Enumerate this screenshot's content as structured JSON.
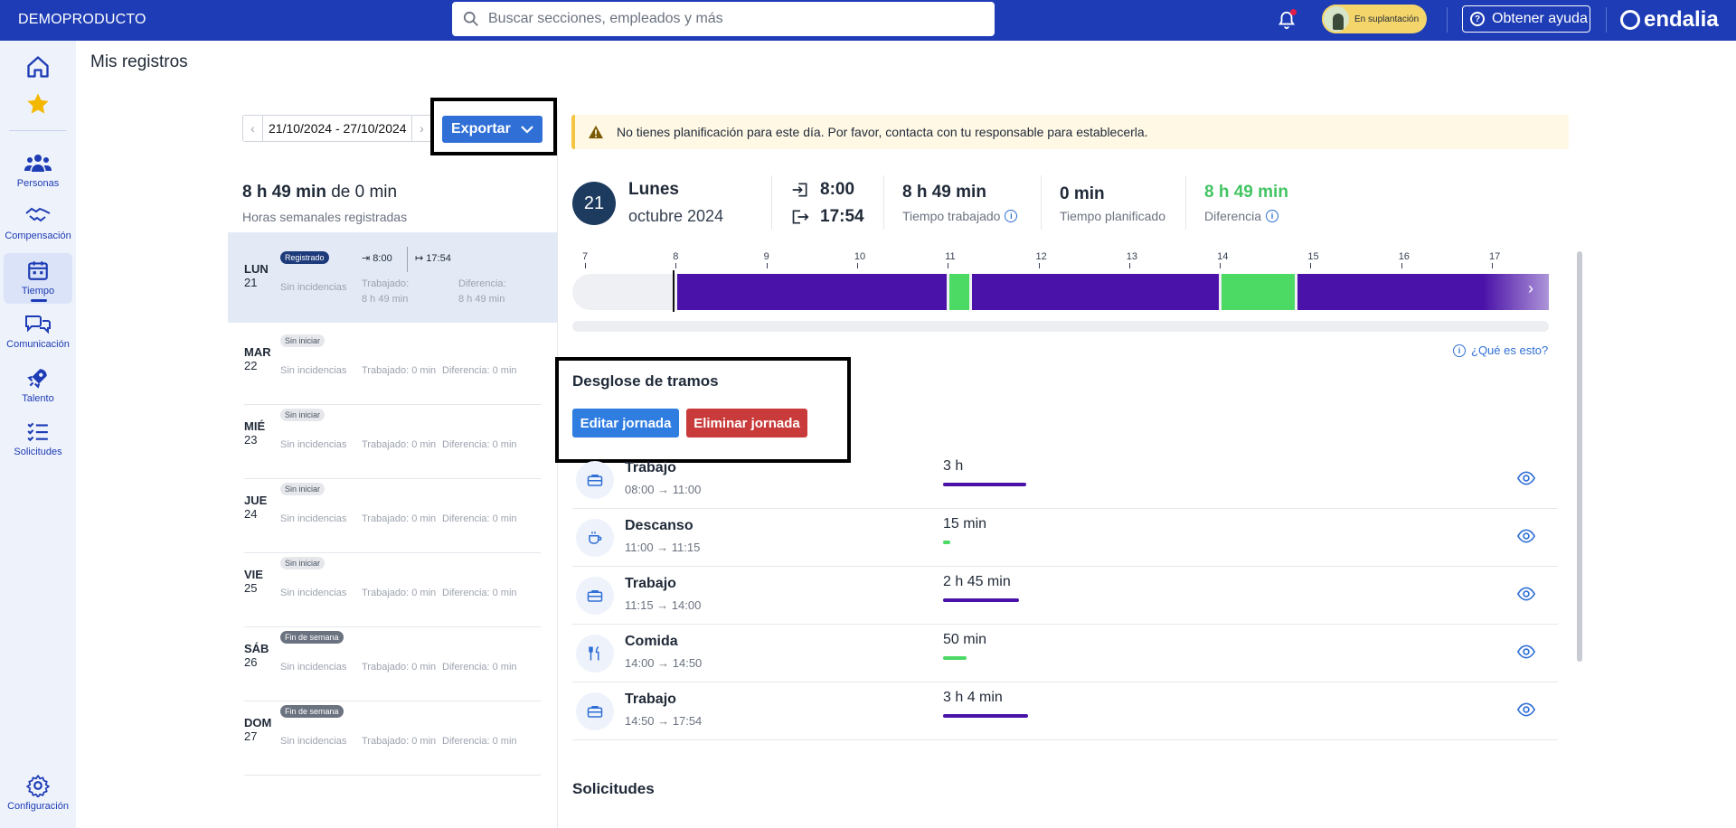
{
  "topbar": {
    "brand": "DEMOPRODUCTO",
    "search_placeholder": "Buscar secciones, empleados y más",
    "impersonation_label": "En suplantación",
    "help_label": "Obtener ayuda",
    "logo_text": "endalia"
  },
  "sidebar": {
    "items": [
      {
        "label": "",
        "icon": "home-icon"
      },
      {
        "label": "",
        "icon": "star-icon"
      },
      {
        "label": "Personas",
        "icon": "people-icon"
      },
      {
        "label": "Compensación",
        "icon": "handshake-icon"
      },
      {
        "label": "Tiempo",
        "icon": "calendar-icon",
        "active": true
      },
      {
        "label": "Comunicación",
        "icon": "chat-icon"
      },
      {
        "label": "Talento",
        "icon": "rocket-icon"
      },
      {
        "label": "Solicitudes",
        "icon": "checklist-icon"
      },
      {
        "label": "Configuración",
        "icon": "gear-icon"
      }
    ]
  },
  "page": {
    "title": "Mis registros"
  },
  "week": {
    "date_range": "21/10/2024 - 27/10/2024",
    "export_label": "Exportar",
    "total": "8 h 49 min",
    "total_of": "de 0 min",
    "subtitle": "Horas semanales registradas",
    "days": [
      {
        "name": "LUN",
        "num": "21",
        "badge": "Registrado",
        "badge_type": "reg",
        "incidences": "Sin incidencias",
        "in": "8:00",
        "out": "17:54",
        "worked_label": "Trabajado:",
        "worked": "8 h 49 min",
        "diff_label": "Diferencia:",
        "diff": "8 h 49 min"
      },
      {
        "name": "MAR",
        "num": "22",
        "badge": "Sin iniciar",
        "badge_type": "sin",
        "incidences": "Sin incidencias",
        "worked": "Trabajado: 0 min",
        "diff": "Diferencia: 0 min"
      },
      {
        "name": "MIÉ",
        "num": "23",
        "badge": "Sin iniciar",
        "badge_type": "sin",
        "incidences": "Sin incidencias",
        "worked": "Trabajado: 0 min",
        "diff": "Diferencia: 0 min"
      },
      {
        "name": "JUE",
        "num": "24",
        "badge": "Sin iniciar",
        "badge_type": "sin",
        "incidences": "Sin incidencias",
        "worked": "Trabajado: 0 min",
        "diff": "Diferencia: 0 min"
      },
      {
        "name": "VIE",
        "num": "25",
        "badge": "Sin iniciar",
        "badge_type": "sin",
        "incidences": "Sin incidencias",
        "worked": "Trabajado: 0 min",
        "diff": "Diferencia: 0 min"
      },
      {
        "name": "SÁB",
        "num": "26",
        "badge": "Fin de semana",
        "badge_type": "fin",
        "incidences": "Sin incidencias",
        "worked": "Trabajado: 0 min",
        "diff": "Diferencia: 0 min"
      },
      {
        "name": "DOM",
        "num": "27",
        "badge": "Fin de semana",
        "badge_type": "fin",
        "incidences": "Sin incidencias",
        "worked": "Trabajado: 0 min",
        "diff": "Diferencia: 0 min"
      }
    ]
  },
  "detail": {
    "alert": "No tienes planificación para este día. Por favor, contacta con tu responsable para establecerla.",
    "day_num": "21",
    "day_name": "Lunes",
    "month_year": "octubre 2024",
    "clock_in": "8:00",
    "clock_out": "17:54",
    "worked_value": "8 h 49 min",
    "worked_label": "Tiempo trabajado",
    "planned_value": "0 min",
    "planned_label": "Tiempo planificado",
    "diff_value": "8 h 49 min",
    "diff_label": "Diferencia",
    "what_is_this": "¿Qué es esto?",
    "timeline_hours": [
      "7",
      "8",
      "9",
      "10",
      "11",
      "12",
      "13",
      "14",
      "15",
      "16",
      "17"
    ],
    "timeline_segments": [
      {
        "start": 8.0,
        "end": 11.0,
        "kind": "work"
      },
      {
        "start": 11.0,
        "end": 11.25,
        "kind": "break"
      },
      {
        "start": 11.25,
        "end": 14.0,
        "kind": "work"
      },
      {
        "start": 14.0,
        "end": 14.833,
        "kind": "break"
      },
      {
        "start": 14.833,
        "end": 17.9,
        "kind": "work"
      }
    ],
    "colors": {
      "work": "#4a12a8",
      "break": "#4cd964",
      "accent": "#2f6fd6",
      "diff": "#43c463"
    },
    "breakdown_title": "Desglose de tramos",
    "edit_label": "Editar jornada",
    "delete_label": "Eliminar jornada",
    "tramos": [
      {
        "name": "Trabajo",
        "range": "08:00 → 11:00",
        "duration": "3 h",
        "kind": "work",
        "icon": "briefcase-icon",
        "minutes": 180
      },
      {
        "name": "Descanso",
        "range": "11:00 → 11:15",
        "duration": "15 min",
        "kind": "break",
        "icon": "coffee-icon",
        "minutes": 15
      },
      {
        "name": "Trabajo",
        "range": "11:15 → 14:00",
        "duration": "2 h 45 min",
        "kind": "work",
        "icon": "briefcase-icon",
        "minutes": 165
      },
      {
        "name": "Comida",
        "range": "14:00 → 14:50",
        "duration": "50 min",
        "kind": "break",
        "icon": "cutlery-icon",
        "minutes": 50
      },
      {
        "name": "Trabajo",
        "range": "14:50 → 17:54",
        "duration": "3 h 4 min",
        "kind": "work",
        "icon": "briefcase-icon",
        "minutes": 184
      }
    ],
    "requests_title": "Solicitudes"
  }
}
